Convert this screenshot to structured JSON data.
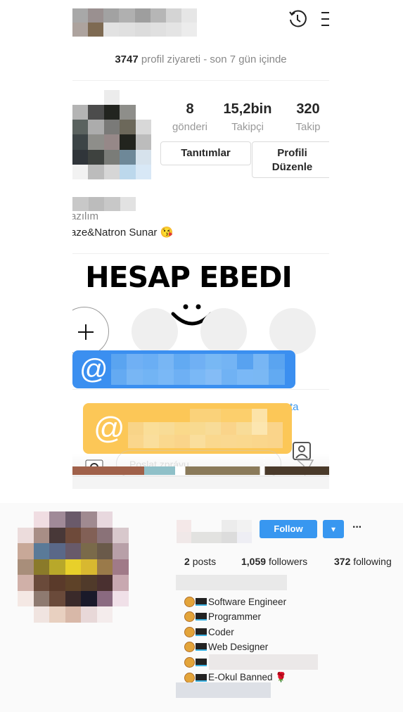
{
  "top_profile": {
    "visits_count": "3747",
    "visits_text": "profil ziyareti - son 7 gün içinde",
    "stats": [
      {
        "value": "8",
        "label": "gönderi"
      },
      {
        "value": "15,2bin",
        "label": "Takipçi"
      },
      {
        "value": "320",
        "label": "Takip"
      }
    ],
    "promotions_button": "Tanıtımlar",
    "edit_profile_button": "Profili Düzenle",
    "bio_line1": "azılım",
    "bio_line2": "aze&Natron Sunar 😘",
    "overlay_title": "HESAP EBEDI",
    "overlay_smile": "◡",
    "blue_mention_symbol": "@",
    "yellow_mention_symbol": "@",
    "partial_link": "ta",
    "message_placeholder": "Poslat zprávu",
    "icons": [
      "history-icon",
      "menu-icon",
      "plus-icon",
      "camera-icon",
      "send-icon",
      "tagged-icon",
      "more-icon"
    ],
    "colors": {
      "blue_bar": "#3b8ff0",
      "yellow_bar": "#fcc757"
    }
  },
  "bottom_profile": {
    "follow_button": "Follow",
    "dropdown_icon": "▾",
    "more_icon": "···",
    "stats": [
      {
        "value": "2",
        "label": "posts"
      },
      {
        "value": "1,059",
        "label": "followers"
      },
      {
        "value": "372",
        "label": "following"
      }
    ],
    "bio": [
      "Software Engineer",
      "Programmer",
      "Coder",
      "Web Designer",
      "",
      "E-Okul Banned 🌹"
    ],
    "colors": {
      "follow": "#3897f0"
    }
  }
}
